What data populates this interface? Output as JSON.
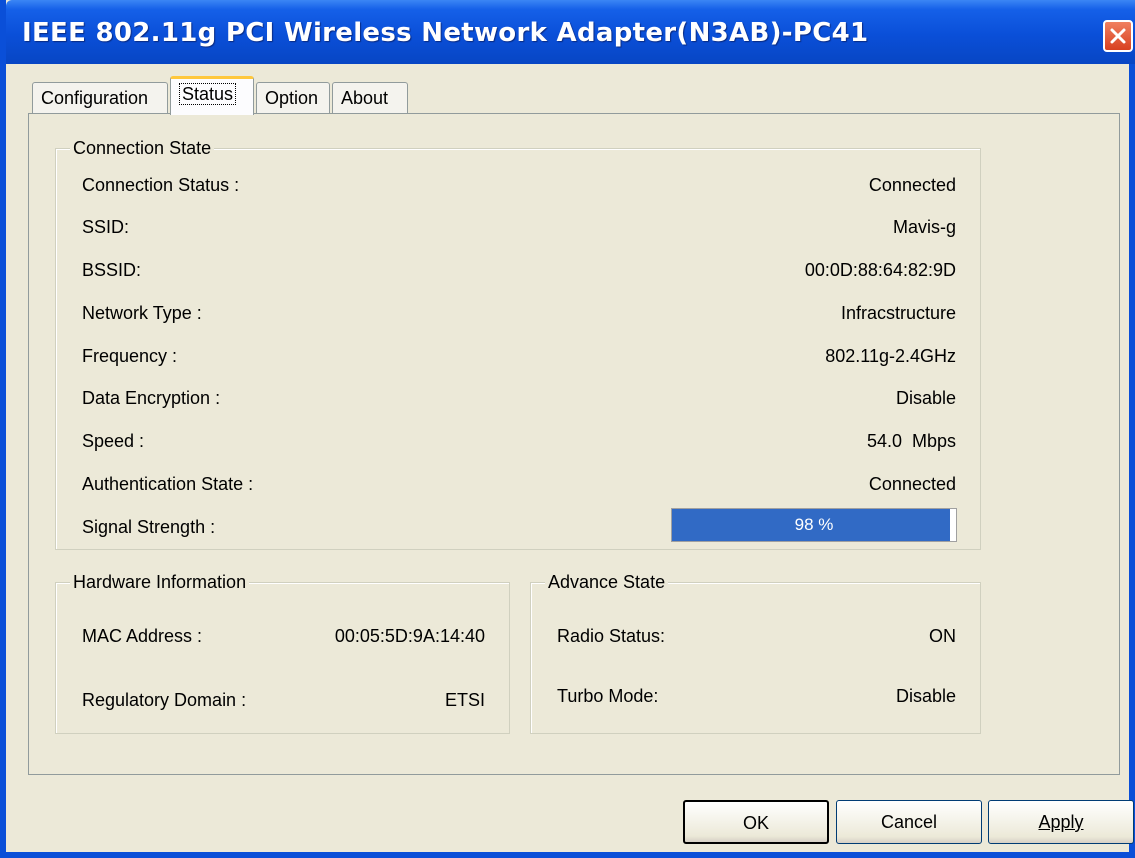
{
  "window": {
    "title": "IEEE 802.11g PCI Wireless Network Adapter(N3AB)-PC41"
  },
  "tabs": [
    {
      "label": "Configuration"
    },
    {
      "label": "Status"
    },
    {
      "label": "Option"
    },
    {
      "label": "About"
    }
  ],
  "active_tab": "Status",
  "connection_state": {
    "legend": "Connection State",
    "rows": [
      {
        "label": "Connection Status :",
        "value": "Connected"
      },
      {
        "label": "SSID:",
        "value": "Mavis-g"
      },
      {
        "label": "BSSID:",
        "value": "00:0D:88:64:82:9D"
      },
      {
        "label": "Network Type :",
        "value": "Infracstructure"
      },
      {
        "label": "Frequency :",
        "value": "802.11g-2.4GHz"
      },
      {
        "label": "Data Encryption :",
        "value": "Disable"
      },
      {
        "label": "Speed :",
        "value": "54.0  Mbps"
      },
      {
        "label": "Authentication State :",
        "value": "Connected"
      }
    ],
    "signal_label": "Signal Strength :",
    "signal_text": "98 %",
    "signal_percent": 98
  },
  "hardware_info": {
    "legend": "Hardware Information",
    "mac_label": "MAC Address :",
    "mac_value": "00:05:5D:9A:14:40",
    "domain_label": "Regulatory Domain :",
    "domain_value": "ETSI"
  },
  "advance_state": {
    "legend": "Advance State",
    "radio_label": "Radio Status:",
    "radio_value": "ON",
    "turbo_label": "Turbo Mode:",
    "turbo_value": "Disable"
  },
  "buttons": {
    "ok": "OK",
    "cancel": "Cancel",
    "apply": "Apply"
  },
  "colors": {
    "titlebar": "#0a4fd8",
    "progress_fill": "#316ac5",
    "tab_highlight": "#ffc83c",
    "close_button": "#d84020"
  }
}
